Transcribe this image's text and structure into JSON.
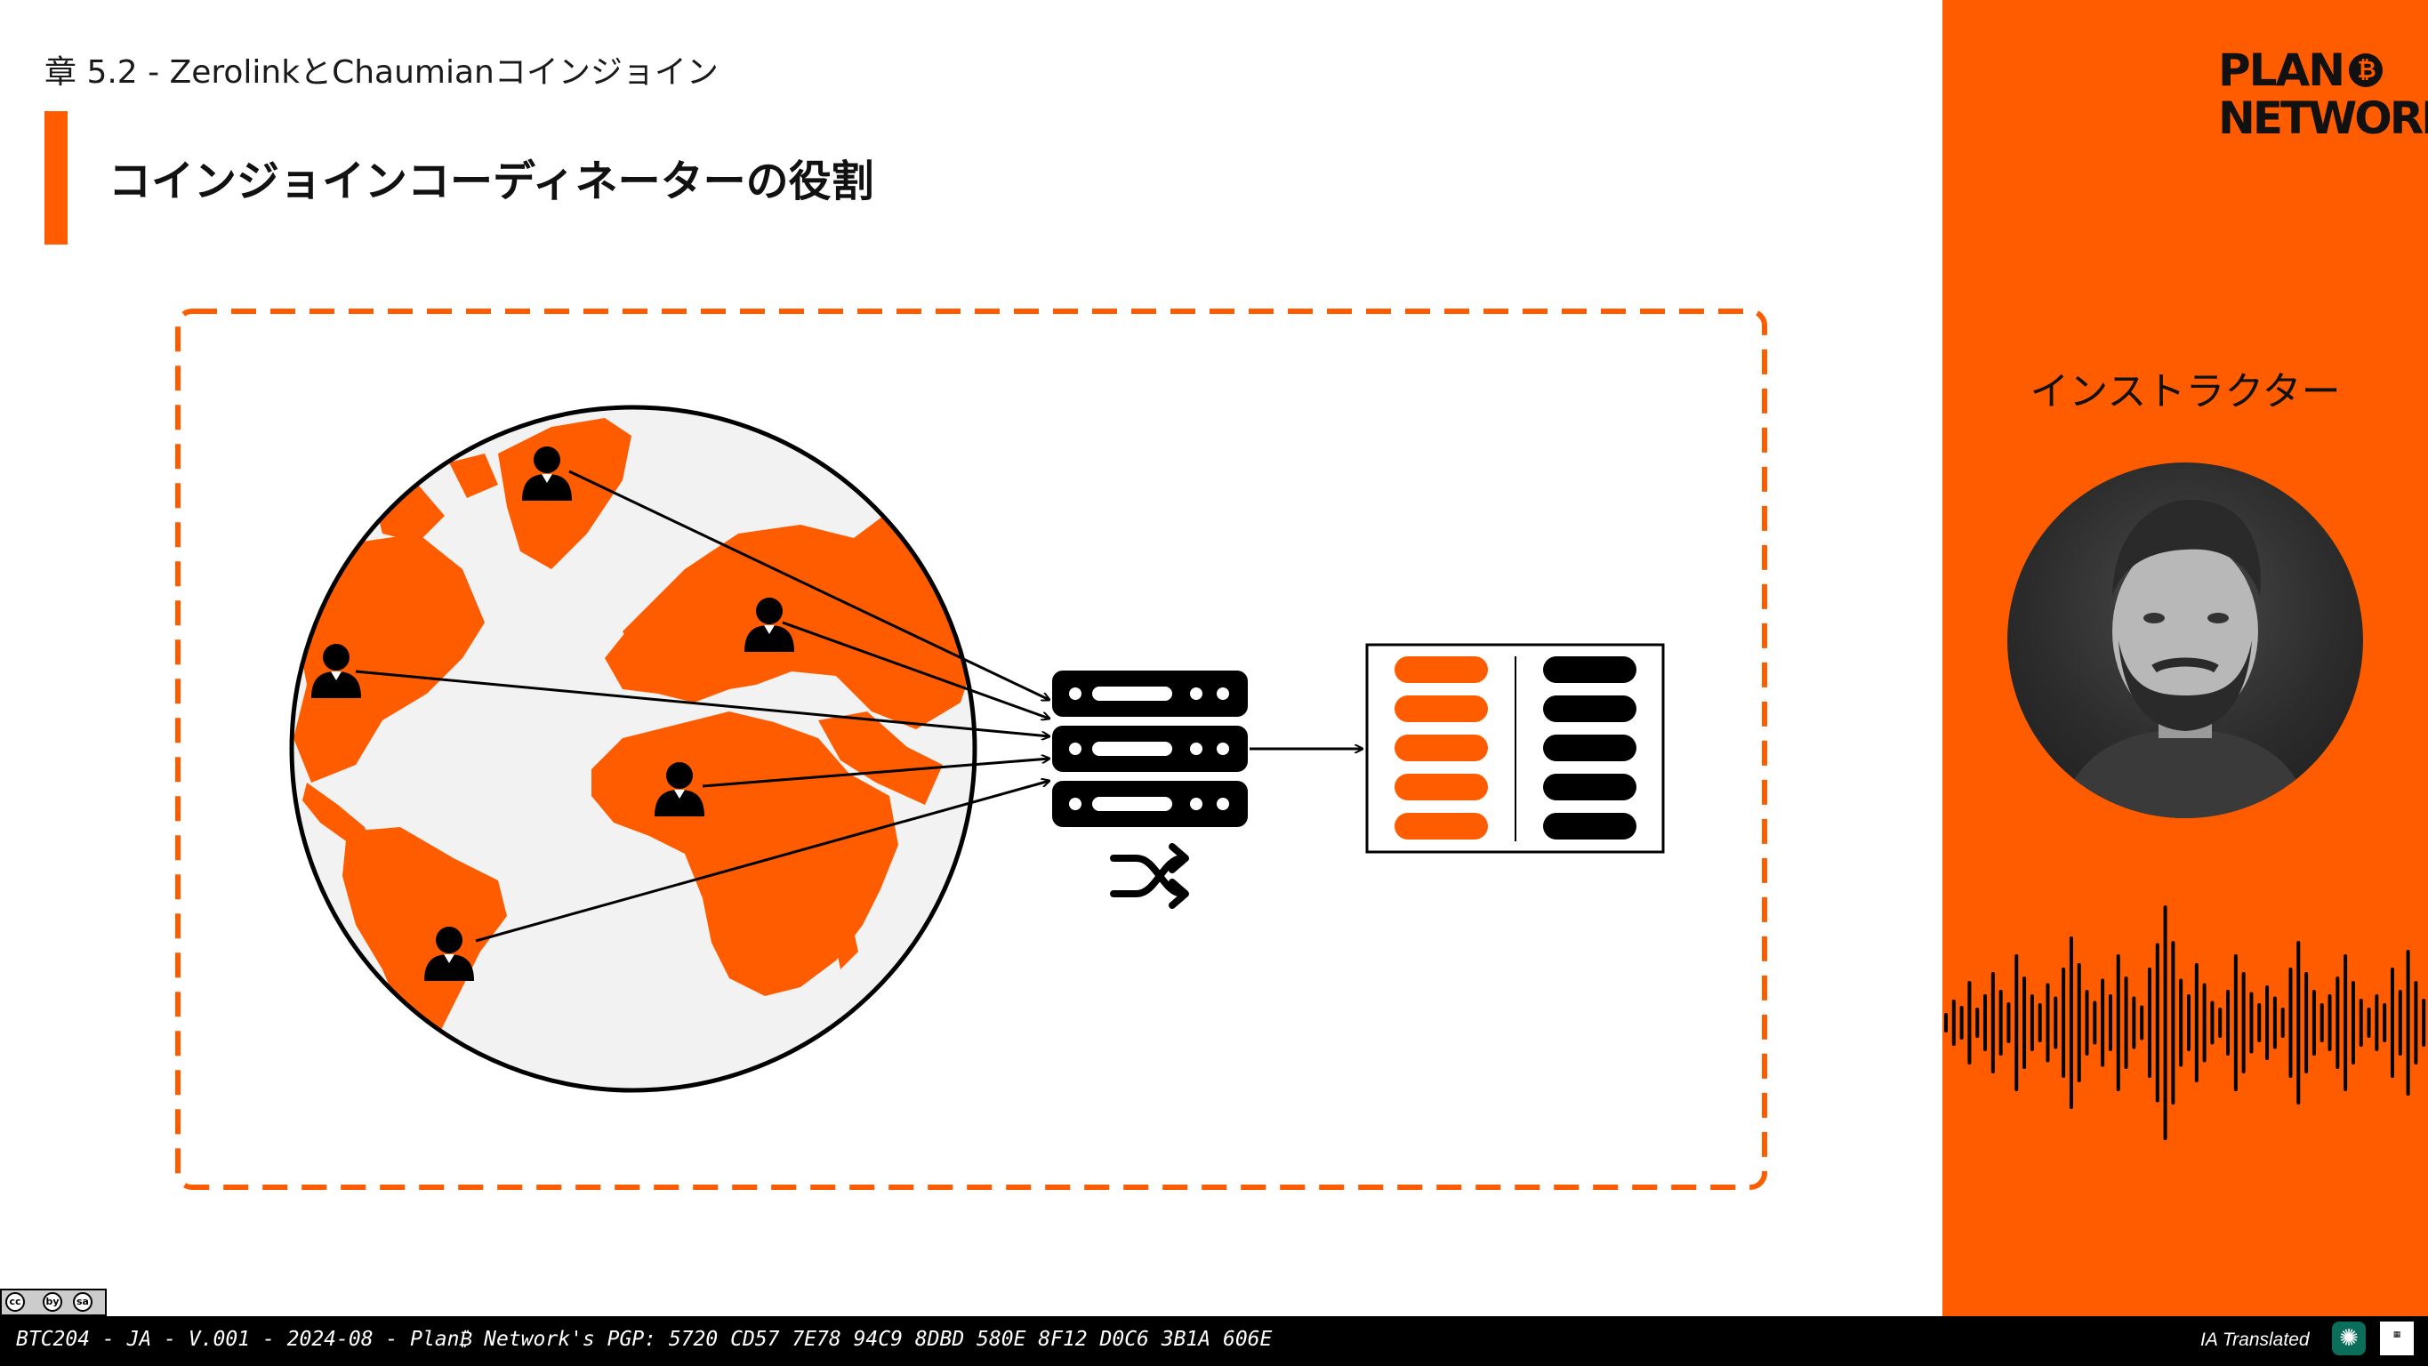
{
  "header": {
    "chapter": "章 5.2 - ZerolinkとChaumianコインジョイン",
    "title": "コインジョインコーディネーターの役割"
  },
  "sidebar": {
    "logo_line1": "PLAN",
    "logo_coin": "₿",
    "logo_line2": "NETWORK",
    "instructor_label": "インストラクター"
  },
  "diagram": {
    "users": [
      "user-greenland",
      "user-europe",
      "user-north-america",
      "user-africa",
      "user-south-america"
    ],
    "server_units": 3,
    "output_rows": 5
  },
  "footer": {
    "license_badges": [
      "cc",
      "by",
      "sa"
    ],
    "info": "BTC204 - JA - V.001 - 2024-08 - Plan₿ Network's PGP: 5720 CD57 7E78 94C9 8DBD 580E 8F12 D0C6 3B1A 606E",
    "ia_label": "IA Translated"
  },
  "colors": {
    "accent": "#ff5c00",
    "ocean": "#f2f2f2",
    "ink": "#000000"
  }
}
